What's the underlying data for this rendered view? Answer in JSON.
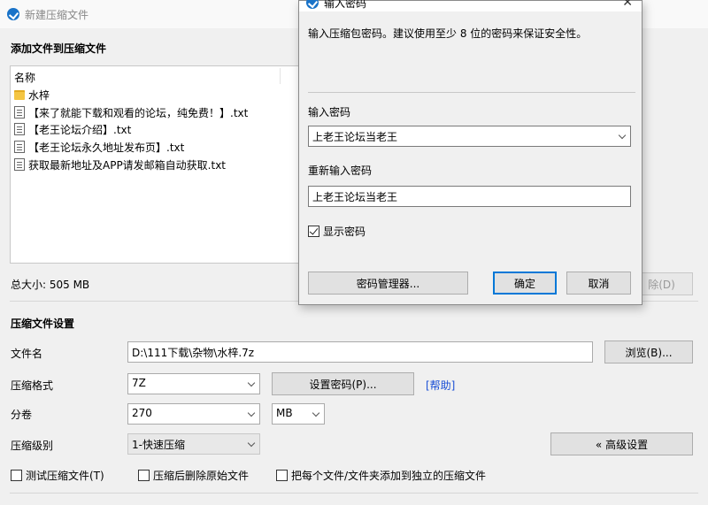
{
  "window": {
    "title": "新建压缩文件"
  },
  "add_files": {
    "heading": "添加文件到压缩文件",
    "column_name": "名称",
    "files": [
      {
        "name": "水梓",
        "icon": "folder-icon"
      },
      {
        "name": "【来了就能下载和观看的论坛，纯免费！】.txt",
        "icon": "text-file-icon"
      },
      {
        "name": "【老王论坛介绍】.txt",
        "icon": "text-file-icon"
      },
      {
        "name": "【老王论坛永久地址发布页】.txt",
        "icon": "text-file-icon"
      },
      {
        "name": "获取最新地址及APP请发邮箱自动获取.txt",
        "icon": "text-file-icon"
      }
    ],
    "total_size": "总大小: 505 MB",
    "remove_button": "除(D)"
  },
  "settings": {
    "heading": "压缩文件设置",
    "filename_label": "文件名",
    "filename_value": "D:\\111下载\\杂物\\水梓.7z",
    "browse_button": "浏览(B)...",
    "format_label": "压缩格式",
    "format_value": "7Z",
    "set_password_button": "设置密码(P)...",
    "help_link": "[帮助]",
    "volume_label": "分卷",
    "volume_value": "270",
    "volume_unit": "MB",
    "level_label": "压缩级别",
    "level_value": "1-快速压缩",
    "advanced_button": "« 高级设置",
    "checks": [
      {
        "label": "测试压缩文件(T)",
        "checked": false
      },
      {
        "label": "压缩后删除原始文件",
        "checked": false
      },
      {
        "label": "把每个文件/文件夹添加到独立的压缩文件",
        "checked": false
      }
    ]
  },
  "password_dialog": {
    "title": "输入密码",
    "close_glyph": "✕",
    "description": "输入压缩包密码。建议使用至少 8 位的密码来保证安全性。",
    "password_label": "输入密码",
    "password_value": "上老王论坛当老王",
    "confirm_label": "重新输入密码",
    "confirm_value": "上老王论坛当老王",
    "show_password_label": "显示密码",
    "show_password_checked": true,
    "manager_button": "密码管理器...",
    "ok_button": "确定",
    "cancel_button": "取消"
  },
  "colors": {
    "accent": "#1a73c8",
    "link": "#1a4fd6",
    "focus": "#0078d7"
  }
}
